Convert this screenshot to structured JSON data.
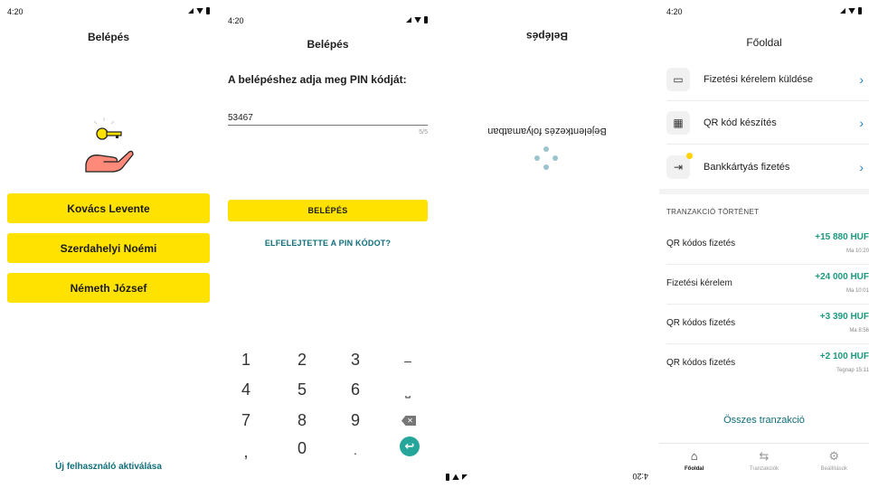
{
  "screen1": {
    "status_time": "4:20",
    "title": "Belépés",
    "users": [
      "Kovács Levente",
      "Szerdahelyi Noémi",
      "Németh József"
    ],
    "activate_link": "Új felhasználó aktiválása"
  },
  "screen2": {
    "status_time": "4:20",
    "title": "Belépés",
    "pin_prompt": "A belépéshez adja meg PIN kódját:",
    "pin_value": "53467",
    "pin_count": "5/5",
    "login_button": "BELÉPÉS",
    "forgot_link": "ELFELEJTETTE A PIN KÓDOT?",
    "keypad": {
      "k1": "1",
      "k2": "2",
      "k3": "3",
      "minus": "–",
      "k4": "4",
      "k5": "5",
      "k6": "6",
      "space": "⎵",
      "k7": "7",
      "k8": "8",
      "k9": "9",
      "backspace": "✕",
      "comma": ",",
      "k0": "0",
      "dot": ".",
      "enter": "↩"
    }
  },
  "screen3": {
    "status_time": "4:20",
    "title": "Belépés",
    "loading_text": "Bejelentkezés folyamatban"
  },
  "screen4": {
    "status_time": "4:20",
    "title": "Főoldal",
    "actions": [
      {
        "label": "Fizetési kérelem küldése",
        "icon": "wallet-icon"
      },
      {
        "label": "QR kód készítés",
        "icon": "qr-code-icon"
      },
      {
        "label": "Bankkártyás fizetés",
        "icon": "card-payment-icon"
      }
    ],
    "history_header": "TRANZAKCIÓ TÖRTÉNET",
    "transactions": [
      {
        "name": "QR kódos fizetés",
        "amount": "+15 880 HUF",
        "time": "Ma 10:20"
      },
      {
        "name": "Fizetési kérelem",
        "amount": "+24 000 HUF",
        "time": "Ma 10:01"
      },
      {
        "name": "QR kódos fizetés",
        "amount": "+3 390 HUF",
        "time": "Ma 8:56"
      },
      {
        "name": "QR kódos fizetés",
        "amount": "+2 100 HUF",
        "time": "Tegnap 15:11"
      }
    ],
    "all_transactions": "Összes tranzakció",
    "nav": {
      "home": "Főoldal",
      "transactions": "Tranzakciók",
      "settings": "Beállítások"
    },
    "colors": {
      "accent_yellow": "#ffe200",
      "teal": "#0f6e7a",
      "amount_green": "#1a9a7e",
      "chevron_blue": "#1e7fc9"
    }
  }
}
